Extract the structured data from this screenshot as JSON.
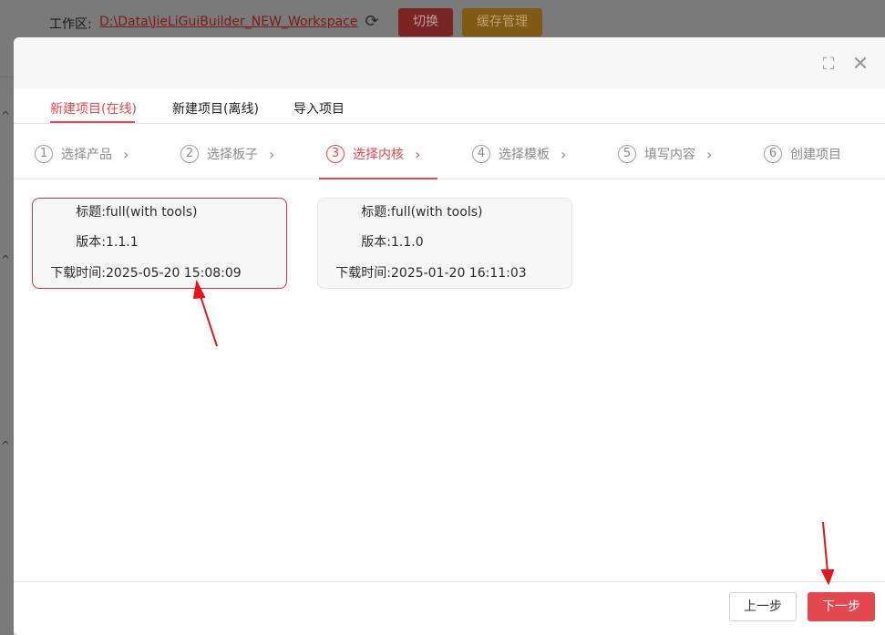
{
  "background": {
    "workspace_label": "工作区:",
    "workspace_path": "D:\\Data\\JieLiGuiBuilder_NEW_Workspace",
    "switch_button": "切换",
    "cache_button": "缓存管理"
  },
  "modal": {
    "tabs": [
      {
        "label": "新建项目(在线)",
        "active": true
      },
      {
        "label": "新建项目(离线)",
        "active": false
      },
      {
        "label": "导入项目",
        "active": false
      }
    ],
    "steps": [
      {
        "num": "1",
        "label": "选择产品"
      },
      {
        "num": "2",
        "label": "选择板子"
      },
      {
        "num": "3",
        "label": "选择内核"
      },
      {
        "num": "4",
        "label": "选择模板"
      },
      {
        "num": "5",
        "label": "填写内容"
      },
      {
        "num": "6",
        "label": "创建项目"
      }
    ],
    "active_step": 3,
    "cards": [
      {
        "title_label": "标题:",
        "title": "full(with tools)",
        "version_label": "版本:",
        "version": "1.1.1",
        "time_label": "下载时间:",
        "time": "2025-05-20 15:08:09",
        "selected": true
      },
      {
        "title_label": "标题:",
        "title": "full(with tools)",
        "version_label": "版本:",
        "version": "1.1.0",
        "time_label": "下载时间:",
        "time": "2025-01-20 16:11:03",
        "selected": false
      }
    ],
    "footer": {
      "prev_button": "上一步",
      "next_button": "下一步"
    }
  },
  "colors": {
    "accent": "#e3474f",
    "annotation_arrow": "#e8141a"
  }
}
